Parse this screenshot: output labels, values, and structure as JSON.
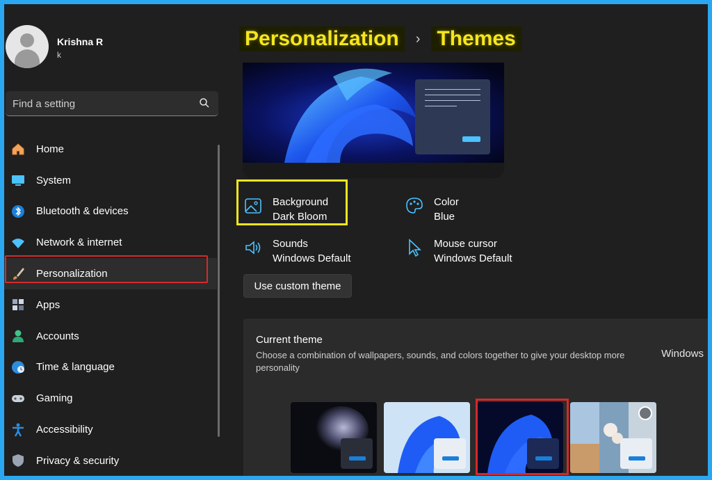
{
  "user": {
    "name": "Krishna R",
    "account": "k"
  },
  "search": {
    "placeholder": "Find a setting"
  },
  "sidebar": {
    "items": [
      {
        "label": "Home",
        "icon": "home-icon"
      },
      {
        "label": "System",
        "icon": "system-icon"
      },
      {
        "label": "Bluetooth & devices",
        "icon": "bluetooth-icon"
      },
      {
        "label": "Network & internet",
        "icon": "wifi-icon"
      },
      {
        "label": "Personalization",
        "icon": "brush-icon",
        "active": true
      },
      {
        "label": "Apps",
        "icon": "apps-icon"
      },
      {
        "label": "Accounts",
        "icon": "accounts-icon"
      },
      {
        "label": "Time & language",
        "icon": "globe-icon"
      },
      {
        "label": "Gaming",
        "icon": "gamepad-icon"
      },
      {
        "label": "Accessibility",
        "icon": "accessibility-icon"
      },
      {
        "label": "Privacy & security",
        "icon": "shield-icon"
      }
    ]
  },
  "header": {
    "section": "Personalization",
    "separator": "›",
    "page": "Themes"
  },
  "options": {
    "background": {
      "title": "Background",
      "value": "Dark Bloom"
    },
    "color": {
      "title": "Color",
      "value": "Blue"
    },
    "sounds": {
      "title": "Sounds",
      "value": "Windows Default"
    },
    "cursor": {
      "title": "Mouse cursor",
      "value": "Windows Default"
    }
  },
  "custom_theme_button": "Use custom theme",
  "current_theme": {
    "title": "Current theme",
    "description": "Choose a combination of wallpapers, sounds, and colors together to give your desktop more personality",
    "value": "Windows"
  },
  "colors": {
    "accent": "#4cc2ff",
    "highlight_red": "#d42a2a",
    "highlight_yellow": "#f5e61e"
  }
}
